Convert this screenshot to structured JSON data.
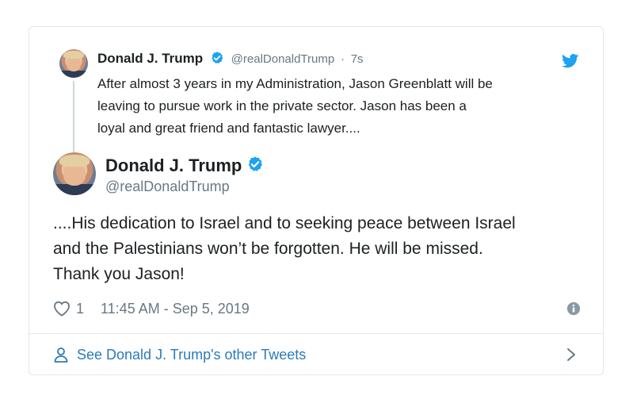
{
  "parent_tweet": {
    "name": "Donald J. Trump",
    "handle": "@realDonaldTrump",
    "separator": "·",
    "time_ago": "7s",
    "text_lines": [
      "After almost 3 years in my Administration, Jason Greenblatt will be",
      "leaving to pursue work in the private sector. Jason has been a",
      "loyal and great friend and fantastic lawyer...."
    ]
  },
  "main_tweet": {
    "name": "Donald J. Trump",
    "handle": "@realDonaldTrump",
    "text_lines": [
      "....His dedication to Israel and to seeking peace between Israel",
      "and the Palestinians won’t be forgotten. He will be missed.",
      "Thank you Jason!"
    ],
    "like_count": "1",
    "timestamp": "11:45 AM - Sep 5, 2019"
  },
  "footer": {
    "see_more_label": "See Donald J. Trump's other Tweets"
  },
  "colors": {
    "twitter_blue": "#1da1f2",
    "link_blue": "#2b7bb9",
    "secondary_text": "#697882",
    "border": "#e1e8ed"
  },
  "icons": {
    "verified": "verified-badge-icon",
    "brand": "twitter-bird-icon",
    "like": "heart-icon",
    "info": "info-icon",
    "profile": "person-icon",
    "next": "chevron-right-icon"
  }
}
